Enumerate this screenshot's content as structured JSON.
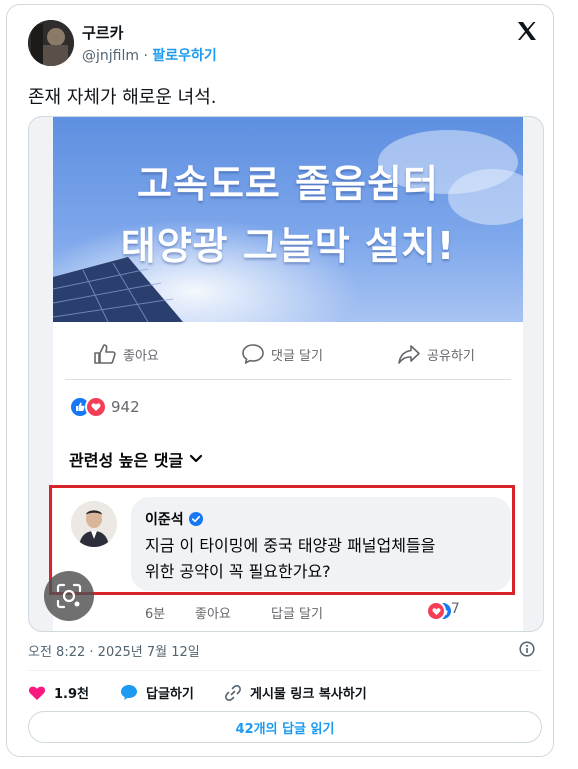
{
  "author": {
    "name": "구르카",
    "handle": "@jnjfilm",
    "separator": "·",
    "follow_label": "팔로우하기"
  },
  "tweet_text": "존재 자체가 해로운 녀석.",
  "embedded_post": {
    "banner_lines": [
      "고속도로 졸음쉼터",
      "태양광 그늘막 설치!"
    ],
    "actions": {
      "like": "좋아요",
      "comment": "댓글 달기",
      "share": "공유하기"
    },
    "reaction_count": "942",
    "sort_label": "관련성 높은 댓글",
    "comment": {
      "author": "이준석",
      "text_line1": "지금 이 타이밍에 중국 태양광 패널업체들을",
      "text_line2": "위한 공약이 꼭 필요한가요?",
      "time": "6분",
      "like": "좋아요",
      "reply": "답글 달기",
      "reaction_count": "117"
    }
  },
  "meta": {
    "time": "오전 8:22",
    "dot": "·",
    "date": "2025년 7월 12일"
  },
  "stats": {
    "likes": "1.9천",
    "reply_label": "답글하기",
    "copy_label": "게시물 링크 복사하기"
  },
  "read_replies": "42개의 답글 읽기",
  "colors": {
    "accent": "#1d9bf0",
    "heart": "#f91880",
    "highlight_border": "#d8232a"
  }
}
